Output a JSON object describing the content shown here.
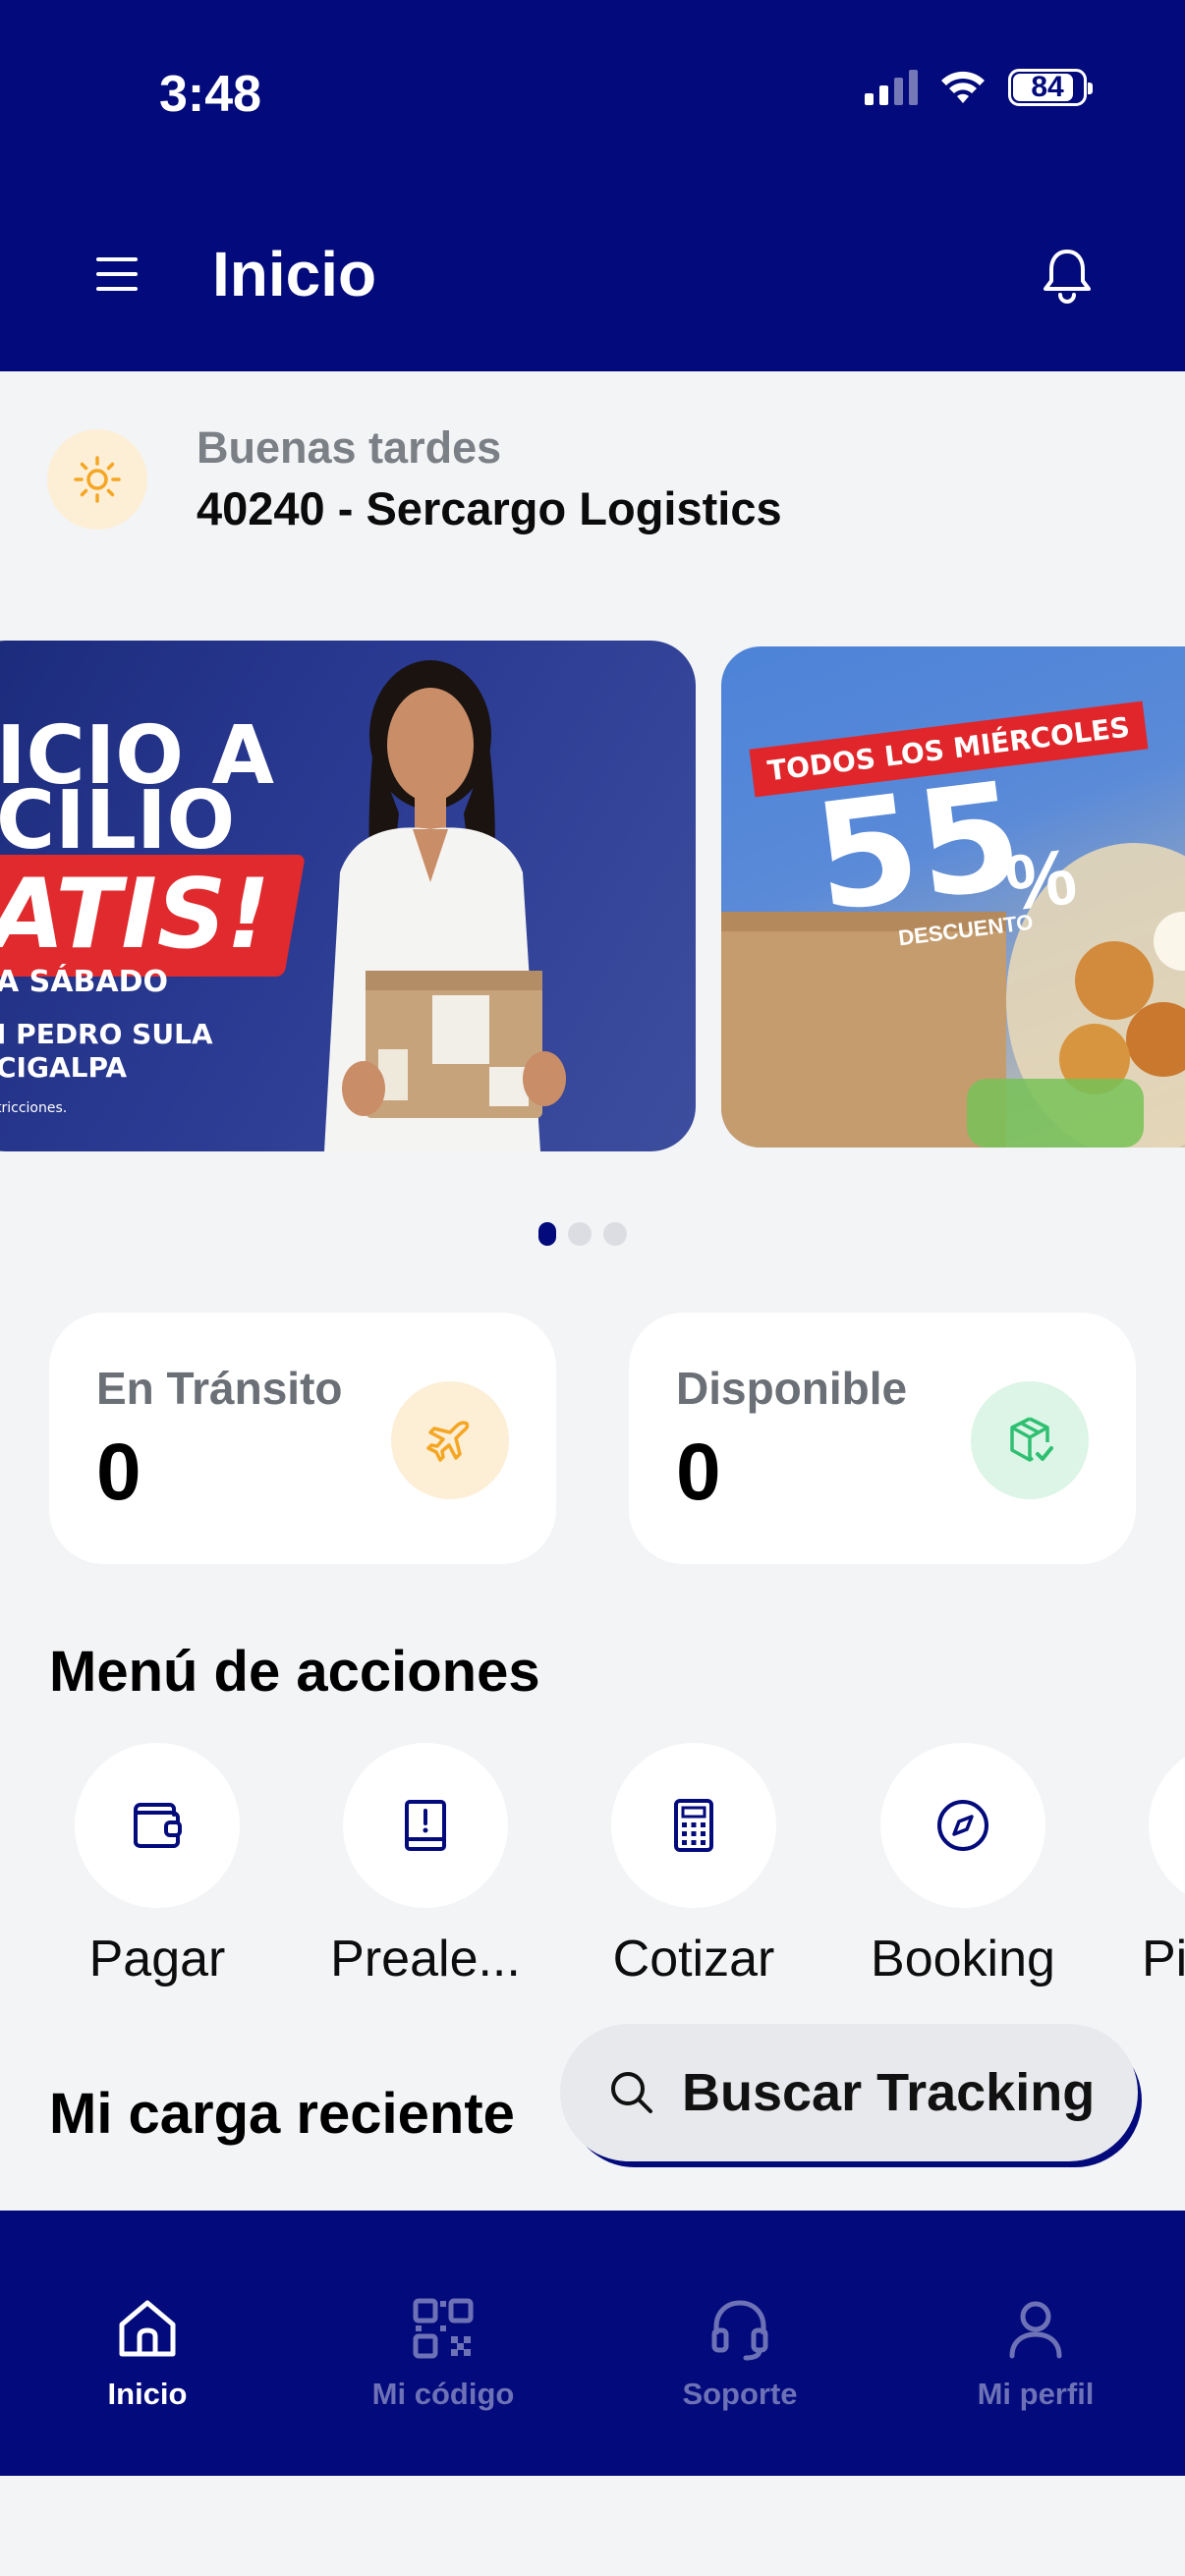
{
  "status_bar": {
    "time": "3:48",
    "battery": "84",
    "icons": [
      "cellular-signal-icon",
      "wifi-icon",
      "battery-icon"
    ]
  },
  "header": {
    "title": "Inicio",
    "menu_icon": "hamburger-icon",
    "notifications_icon": "bell-icon"
  },
  "greeting": {
    "salutation": "Buenas tardes",
    "account": "40240 - Sercargo Logistics",
    "icon": "sun-icon"
  },
  "banners": [
    {
      "lines": [
        "ICIO A",
        "CILIO",
        "ATIS!",
        "A SÁBADO",
        "I PEDRO SULA",
        "CIGALPA",
        "tricciones."
      ]
    },
    {
      "tag": "TODOS LOS MIÉRCOLES",
      "number": "55",
      "percent": "%",
      "subtitle": "DESCUENTO"
    }
  ],
  "carousel": {
    "pages": 3,
    "active_index": 0
  },
  "stats": [
    {
      "label": "En Tránsito",
      "value": "0",
      "icon": "airplane-icon",
      "icon_bg": "#fdeed6",
      "icon_color": "#f5a623"
    },
    {
      "label": "Disponible",
      "value": "0",
      "icon": "package-check-icon",
      "icon_bg": "#dcf5e7",
      "icon_color": "#2fbf71"
    }
  ],
  "actions_section": {
    "title": "Menú de acciones",
    "items": [
      {
        "label": "Pagar",
        "icon": "wallet-icon"
      },
      {
        "label": "Preale...",
        "icon": "book-alert-icon"
      },
      {
        "label": "Cotizar",
        "icon": "calculator-icon"
      },
      {
        "label": "Booking",
        "icon": "compass-icon"
      },
      {
        "label": "Pi",
        "icon": "partial-icon"
      }
    ]
  },
  "recent": {
    "title": "Mi carga reciente"
  },
  "search": {
    "label": "Buscar Tracking",
    "icon": "search-icon"
  },
  "bottom_nav": [
    {
      "label": "Inicio",
      "icon": "home-icon",
      "active": true
    },
    {
      "label": "Mi código",
      "icon": "qr-code-icon",
      "active": false
    },
    {
      "label": "Soporte",
      "icon": "headset-icon",
      "active": false
    },
    {
      "label": "Mi perfil",
      "icon": "user-icon",
      "active": false
    }
  ],
  "colors": {
    "brand_navy": "#030a7b",
    "background": "#f3f4f6",
    "card": "#ffffff",
    "promo_red": "#e12a2d"
  }
}
